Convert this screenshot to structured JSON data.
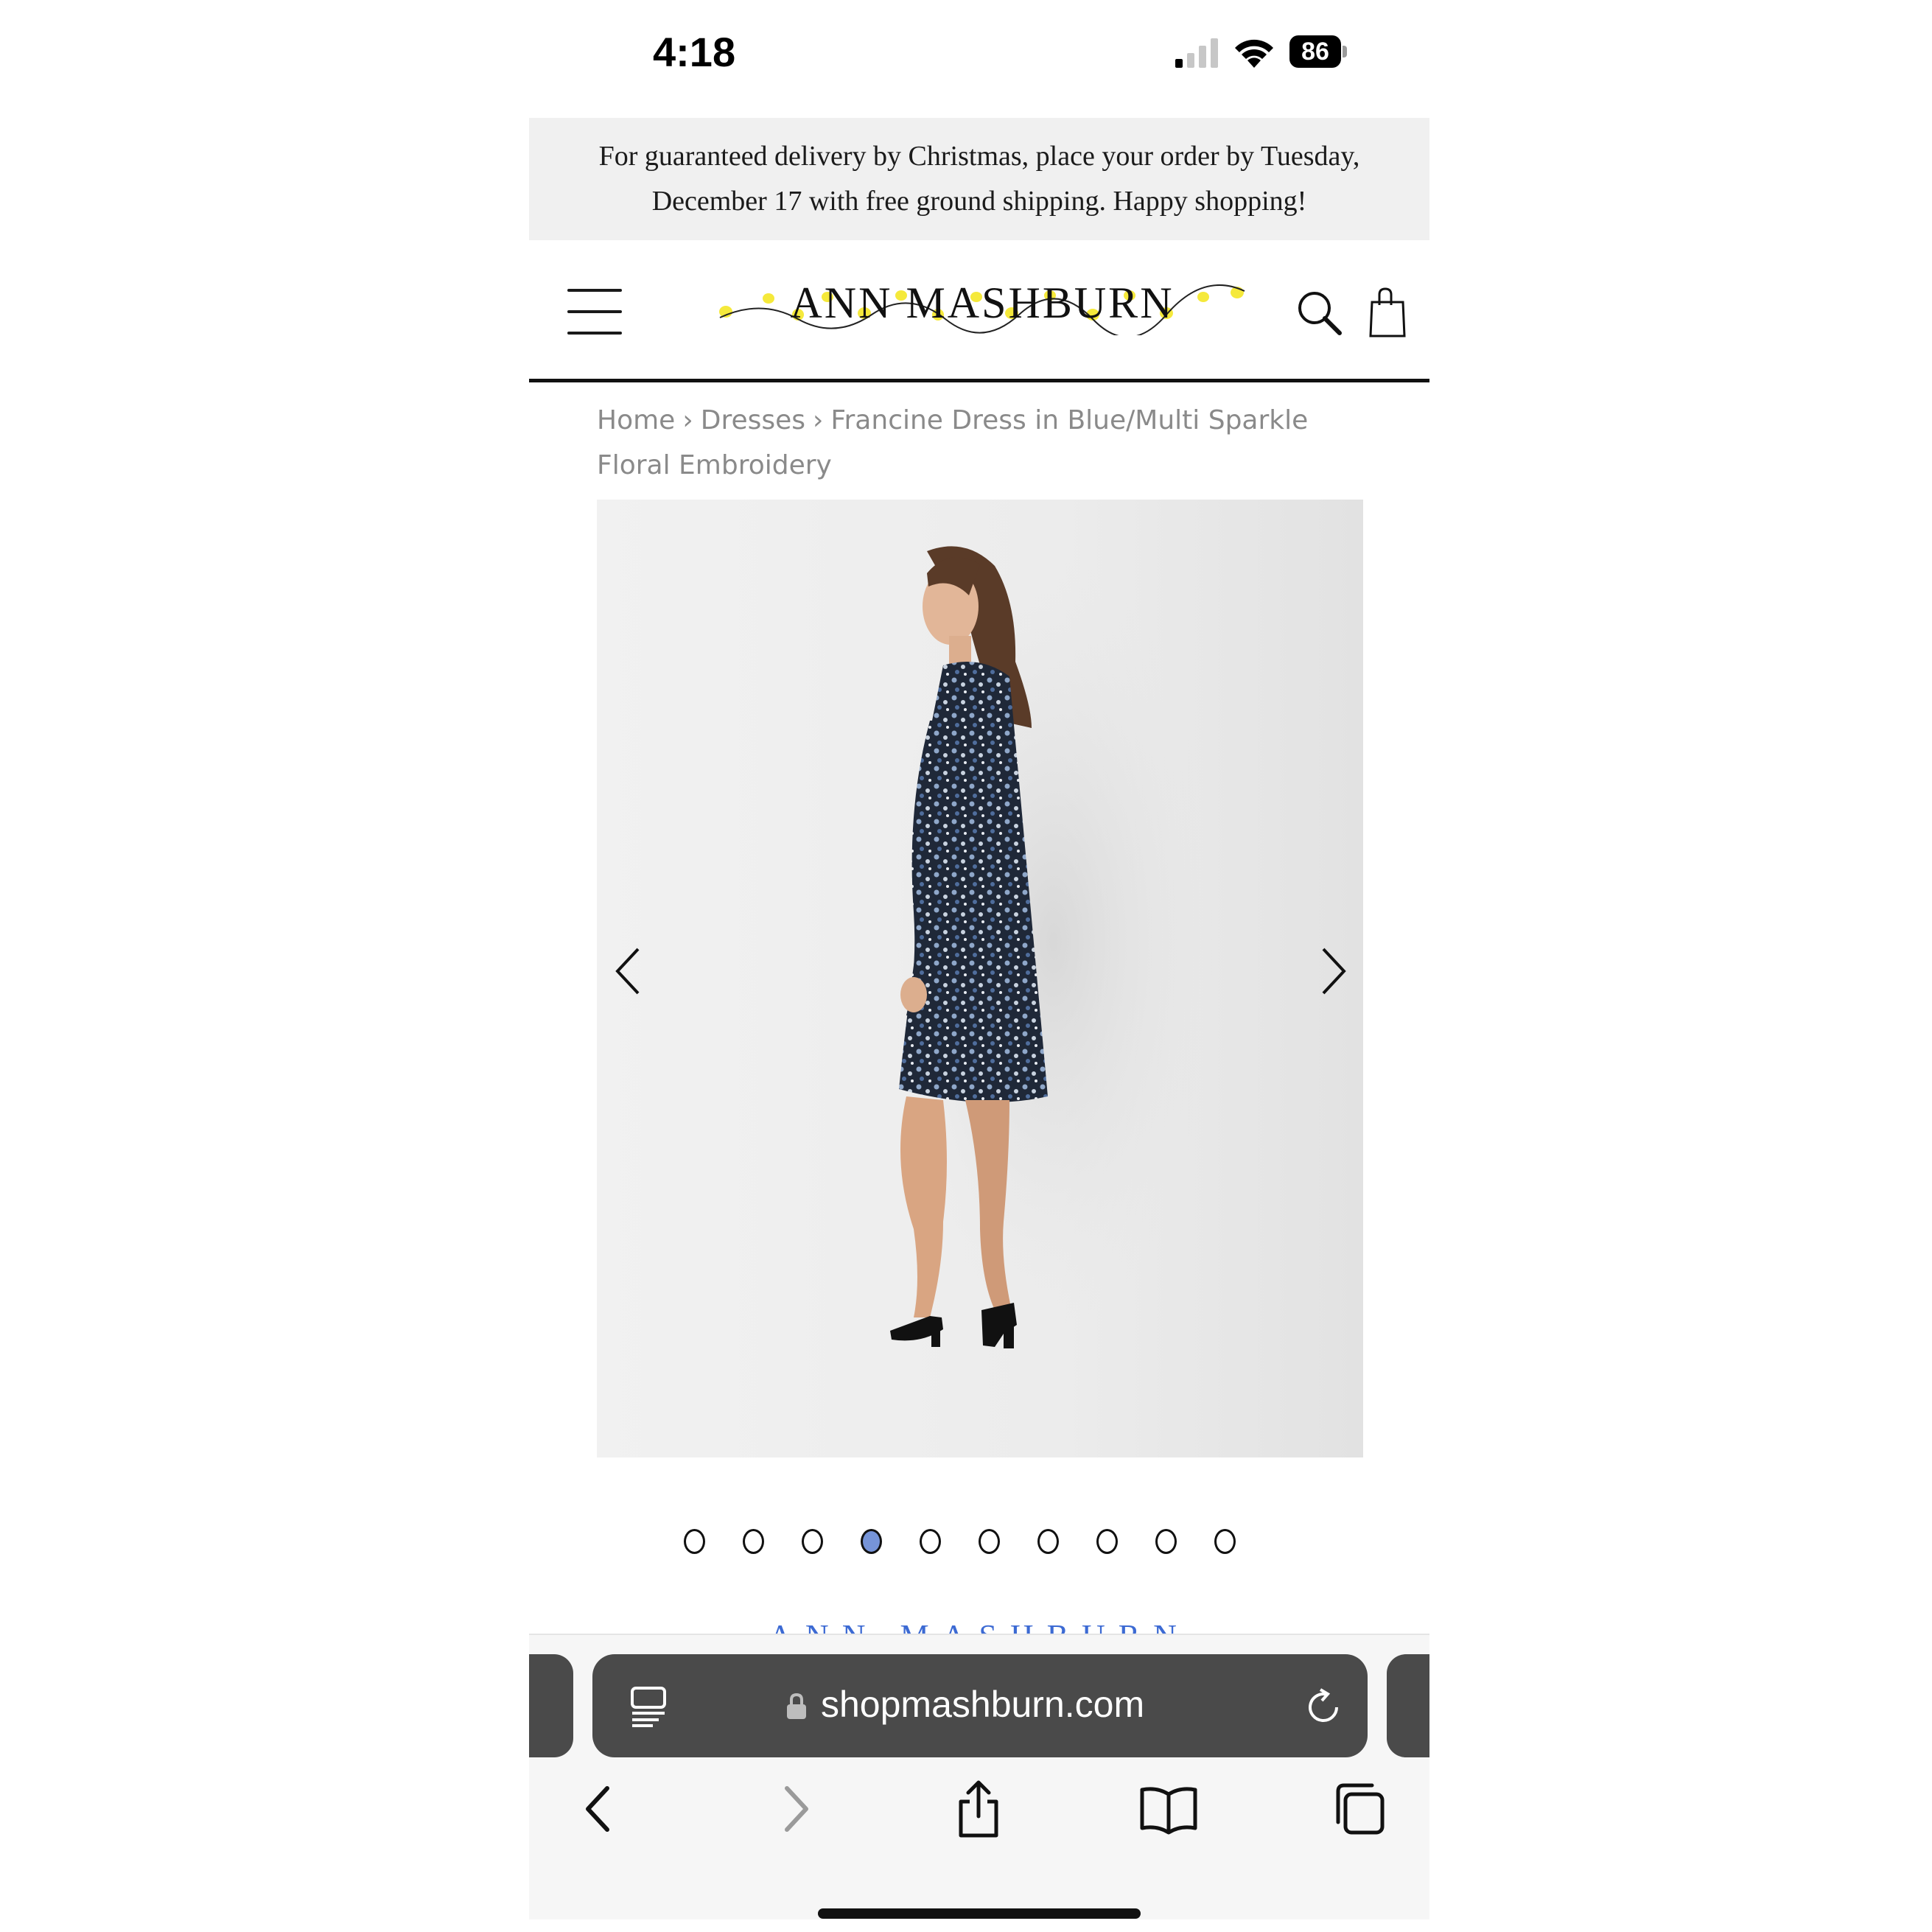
{
  "status_bar": {
    "time": "4:18",
    "battery_level": "86",
    "signal_bars_active": 1,
    "signal_bars_total": 4
  },
  "banner": {
    "text": "For guaranteed delivery by Christmas, place your order by Tuesday, December 17 with free ground shipping. Happy shopping!"
  },
  "header": {
    "logo_text": "ANN MASHBURN",
    "menu_icon": "hamburger-menu-icon",
    "search_icon": "search-icon",
    "bag_icon": "shopping-bag-icon"
  },
  "breadcrumb": {
    "items": [
      "Home",
      "Dresses",
      "Francine Dress in Blue/Multi Sparkle Floral Embroidery"
    ],
    "separator": "›"
  },
  "gallery": {
    "image_alt": "Model wearing Francine Dress in Blue/Multi Sparkle Floral Embroidery",
    "prev_icon": "chevron-left-icon",
    "next_icon": "chevron-right-icon",
    "slide_count": 10,
    "active_slide": 4
  },
  "brand_peek": "ANN MASHBURN",
  "browser": {
    "url": "shopmashburn.com",
    "reader_icon": "reader-mode-icon",
    "lock_icon": "lock-icon",
    "reload_icon": "reload-icon",
    "toolbar": [
      "back-icon",
      "forward-icon",
      "share-icon",
      "bookmarks-icon",
      "tabs-icon"
    ]
  },
  "colors": {
    "banner_bg": "#f0f0f0",
    "active_dot": "#7694d8",
    "brand_blue": "#3c6ad3",
    "address_bar": "#4a4a4a",
    "logo_highlight": "#f5e93b"
  }
}
